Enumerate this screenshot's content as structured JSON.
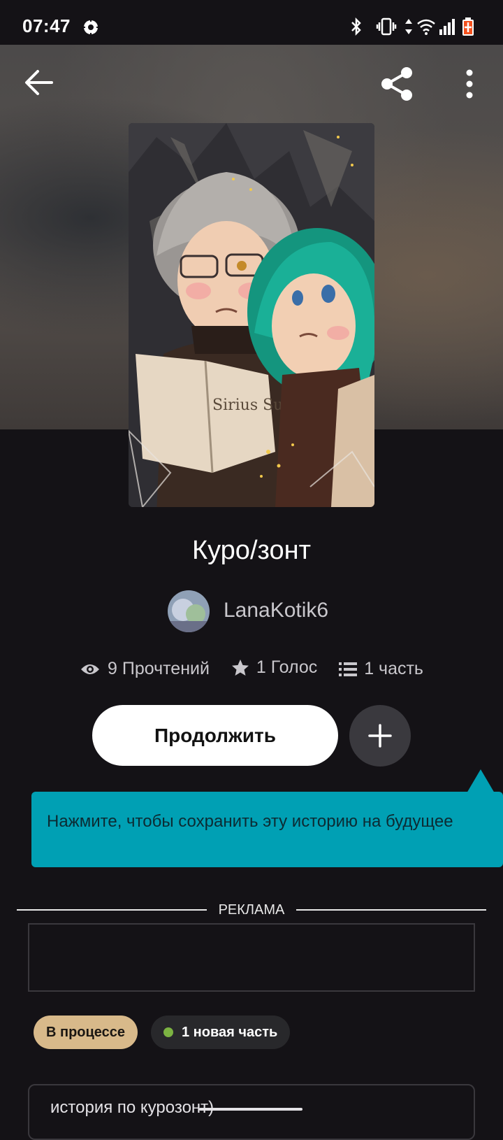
{
  "status_bar": {
    "time": "07:47",
    "icons": [
      "settings-icon",
      "bluetooth-icon",
      "vibrate-icon",
      "data-arrows-icon",
      "wifi-icon",
      "signal-icon",
      "battery-charging-icon"
    ]
  },
  "toolbar": {
    "back_icon": "back-arrow-icon",
    "share_icon": "share-icon",
    "more_icon": "more-vertical-icon"
  },
  "story": {
    "cover_text": "Sirius Sunet",
    "title": "Куро/зонт",
    "author": "LanaKotik6",
    "stats": {
      "reads": "9 Прочтений",
      "votes": "1 Голос",
      "parts": "1 часть"
    }
  },
  "actions": {
    "continue_label": "Продолжить",
    "add_icon": "plus-icon"
  },
  "tooltip": {
    "text": "Нажмите, чтобы сохранить эту историю на будущее"
  },
  "ad": {
    "label": "РЕКЛАМА"
  },
  "badges": {
    "status": "В процессе",
    "new_parts": "1 новая часть"
  },
  "description": {
    "text": "история по курозонт)"
  },
  "colors": {
    "background": "#141216",
    "tooltip": "#00a0b4",
    "status_badge": "#d8b98a",
    "new_dot": "#7cb342",
    "battery": "#f4511e"
  }
}
